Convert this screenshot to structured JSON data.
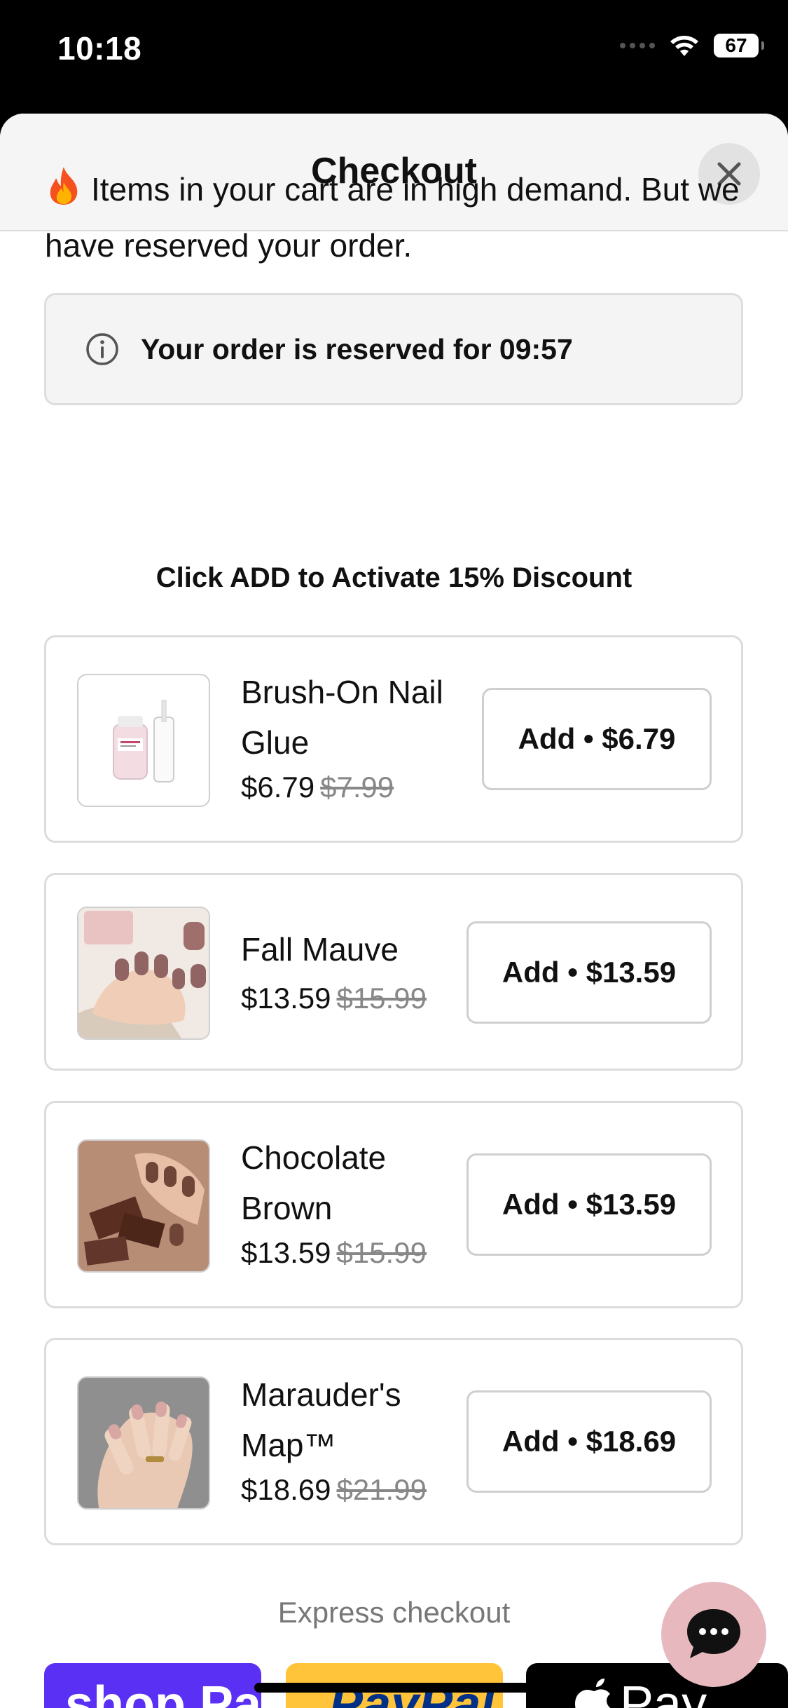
{
  "status_bar": {
    "time": "10:18",
    "battery": "67"
  },
  "header": {
    "title": "Checkout"
  },
  "notice": {
    "emoji": "🔥",
    "text": "Items in your cart are in high demand. But we have reserved your order."
  },
  "reservation": {
    "text": "Your order is reserved for 09:57"
  },
  "upsell": {
    "heading": "Click ADD to Activate 15% Discount",
    "products": [
      {
        "name": "Brush-On Nail Glue",
        "price": "$6.79",
        "old_price": "$7.99",
        "button": "Add • $6.79",
        "image": "nail-glue-bottle"
      },
      {
        "name": "Fall Mauve",
        "price": "$13.59",
        "old_price": "$15.99",
        "button": "Add • $13.59",
        "image": "mauve-nails-photo"
      },
      {
        "name": "Chocolate Brown",
        "price": "$13.59",
        "old_price": "$15.99",
        "button": "Add • $13.59",
        "image": "brown-nails-photo"
      },
      {
        "name": "Marauder's Map™",
        "price": "$18.69",
        "old_price": "$21.99",
        "button": "Add • $18.69",
        "image": "nude-nails-photo"
      }
    ]
  },
  "express": {
    "label": "Express checkout",
    "buttons": [
      {
        "label": "shop Pay",
        "color": "#5a31f4"
      },
      {
        "label": "PayPal",
        "color": "#ffc439"
      },
      {
        "label": "Pay",
        "color": "#000000"
      }
    ]
  },
  "colors": {
    "chat_bubble": "#e7b8bd",
    "border": "#dcdcdc",
    "header_bg": "#f5f5f5"
  }
}
